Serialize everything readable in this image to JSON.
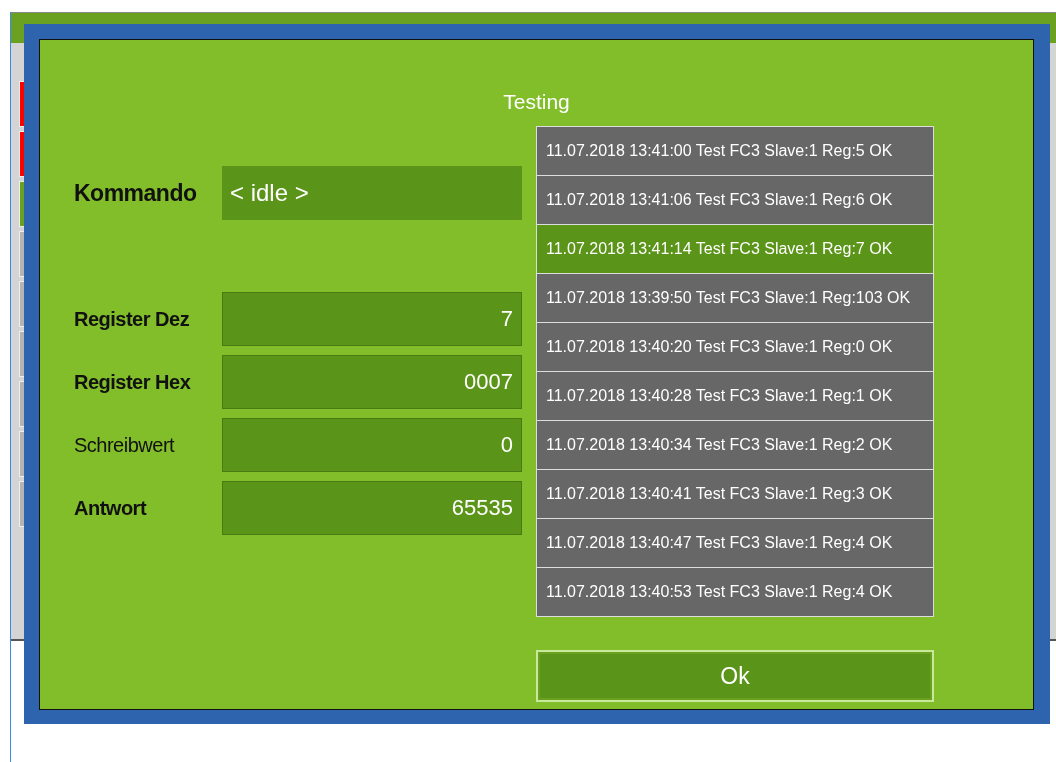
{
  "background": {
    "tiles": [
      {
        "color": "#ff0000"
      },
      {
        "color": "#ff0000"
      },
      {
        "color": "#6aa121"
      },
      {
        "color": "#b4b4b4"
      },
      {
        "color": "#b4b4b4"
      },
      {
        "color": "#b4b4b4"
      },
      {
        "color": "#b4b4b4"
      },
      {
        "color": "#b4b4b4"
      },
      {
        "color": "#b4b4b4"
      }
    ]
  },
  "dialog": {
    "title": "Testing",
    "command": {
      "label": "Kommando",
      "value": "< idle >"
    },
    "fields": [
      {
        "label": "Register Dez",
        "value": "7",
        "bold": true
      },
      {
        "label": "Register Hex",
        "value": "0007",
        "bold": true
      },
      {
        "label": "Schreibwert",
        "value": "0",
        "bold": false
      },
      {
        "label": "Antwort",
        "value": "65535",
        "bold": true
      }
    ],
    "log": [
      {
        "text": "11.07.2018 13:41:00 Test FC3 Slave:1 Reg:5 OK",
        "selected": false
      },
      {
        "text": "11.07.2018 13:41:06 Test FC3 Slave:1 Reg:6 OK",
        "selected": false
      },
      {
        "text": "11.07.2018 13:41:14 Test FC3 Slave:1 Reg:7 OK",
        "selected": true
      },
      {
        "text": "11.07.2018 13:39:50 Test FC3 Slave:1 Reg:103 OK",
        "selected": false
      },
      {
        "text": "11.07.2018 13:40:20 Test FC3 Slave:1 Reg:0 OK",
        "selected": false
      },
      {
        "text": "11.07.2018 13:40:28 Test FC3 Slave:1 Reg:1 OK",
        "selected": false
      },
      {
        "text": "11.07.2018 13:40:34 Test FC3 Slave:1 Reg:2 OK",
        "selected": false
      },
      {
        "text": "11.07.2018 13:40:41 Test FC3 Slave:1 Reg:3 OK",
        "selected": false
      },
      {
        "text": "11.07.2018 13:40:47 Test FC3 Slave:1 Reg:4 OK",
        "selected": false
      },
      {
        "text": "11.07.2018 13:40:53 Test FC3 Slave:1 Reg:4 OK",
        "selected": false
      }
    ],
    "ok_button": "Ok"
  }
}
